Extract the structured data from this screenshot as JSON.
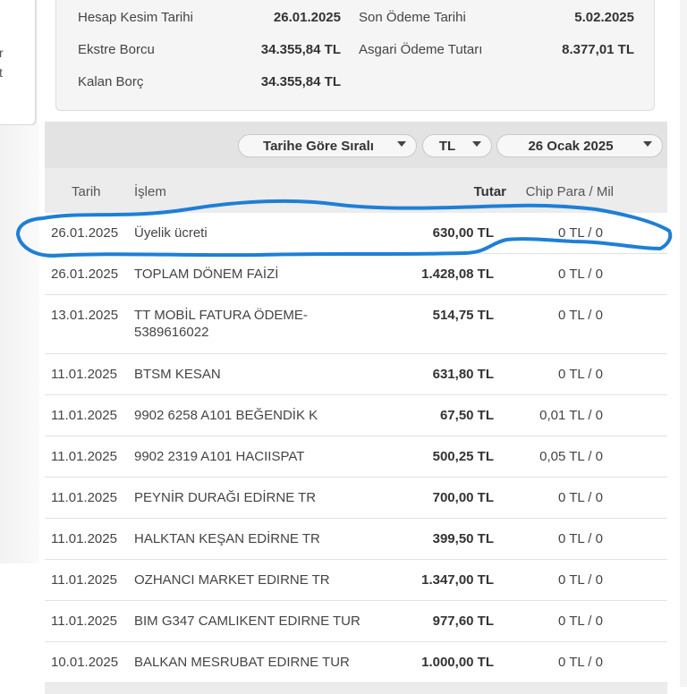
{
  "left_card": {
    "fragment_1": "r",
    "fragment_2": "t"
  },
  "summary": {
    "statement_date_label": "Hesap Kesim Tarihi",
    "statement_date_value": "26.01.2025",
    "due_date_label": "Son Ödeme Tarihi",
    "due_date_value": "5.02.2025",
    "statement_debt_label": "Ekstre Borcu",
    "statement_debt_value": "34.355,84 TL",
    "min_payment_label": "Asgari Ödeme Tutarı",
    "min_payment_value": "8.377,01 TL",
    "remaining_debt_label": "Kalan Borç",
    "remaining_debt_value": "34.355,84 TL"
  },
  "toolbar": {
    "sort_label": "Tarihe Göre Sıralı",
    "currency_label": "TL",
    "period_label": "26 Ocak 2025"
  },
  "table": {
    "headers": {
      "date": "Tarih",
      "transaction": "İşlem",
      "amount": "Tutar",
      "chip": "Chip Para / Mil"
    },
    "rows": [
      {
        "date": "26.01.2025",
        "desc": "Üyelik ücreti",
        "amount": "630,00 TL",
        "chip": "0 TL / 0"
      },
      {
        "date": "26.01.2025",
        "desc": "TOPLAM DÖNEM FAİZİ",
        "amount": "1.428,08 TL",
        "chip": "0 TL / 0"
      },
      {
        "date": "13.01.2025",
        "desc": "TT MOBİL FATURA ÖDEME-\n5389616022",
        "amount": "514,75 TL",
        "chip": "0 TL / 0"
      },
      {
        "date": "11.01.2025",
        "desc": "BTSM KESAN",
        "amount": "631,80 TL",
        "chip": "0 TL / 0"
      },
      {
        "date": "11.01.2025",
        "desc": "9902 6258 A101 BEĞENDİK K",
        "amount": "67,50 TL",
        "chip": "0,01 TL / 0"
      },
      {
        "date": "11.01.2025",
        "desc": "9902 2319 A101 HACIISPAT",
        "amount": "500,25 TL",
        "chip": "0,05 TL / 0"
      },
      {
        "date": "11.01.2025",
        "desc": "PEYNİR DURAĞI EDİRNE TR",
        "amount": "700,00 TL",
        "chip": "0 TL / 0"
      },
      {
        "date": "11.01.2025",
        "desc": "HALKTAN KEŞAN EDİRNE TR",
        "amount": "399,50 TL",
        "chip": "0 TL / 0"
      },
      {
        "date": "11.01.2025",
        "desc": "OZHANCI MARKET EDIRNE TR",
        "amount": "1.347,00 TL",
        "chip": "0 TL / 0"
      },
      {
        "date": "11.01.2025",
        "desc": "BIM G347 CAMLIKENT EDIRNE TUR",
        "amount": "977,60 TL",
        "chip": "0 TL / 0"
      },
      {
        "date": "10.01.2025",
        "desc": "BALKAN MESRUBAT EDIRNE TUR",
        "amount": "1.000,00 TL",
        "chip": "0 TL / 0"
      }
    ]
  },
  "colors": {
    "accent_yellow": "#f6c500",
    "annotation_blue": "#1e7fd6"
  }
}
